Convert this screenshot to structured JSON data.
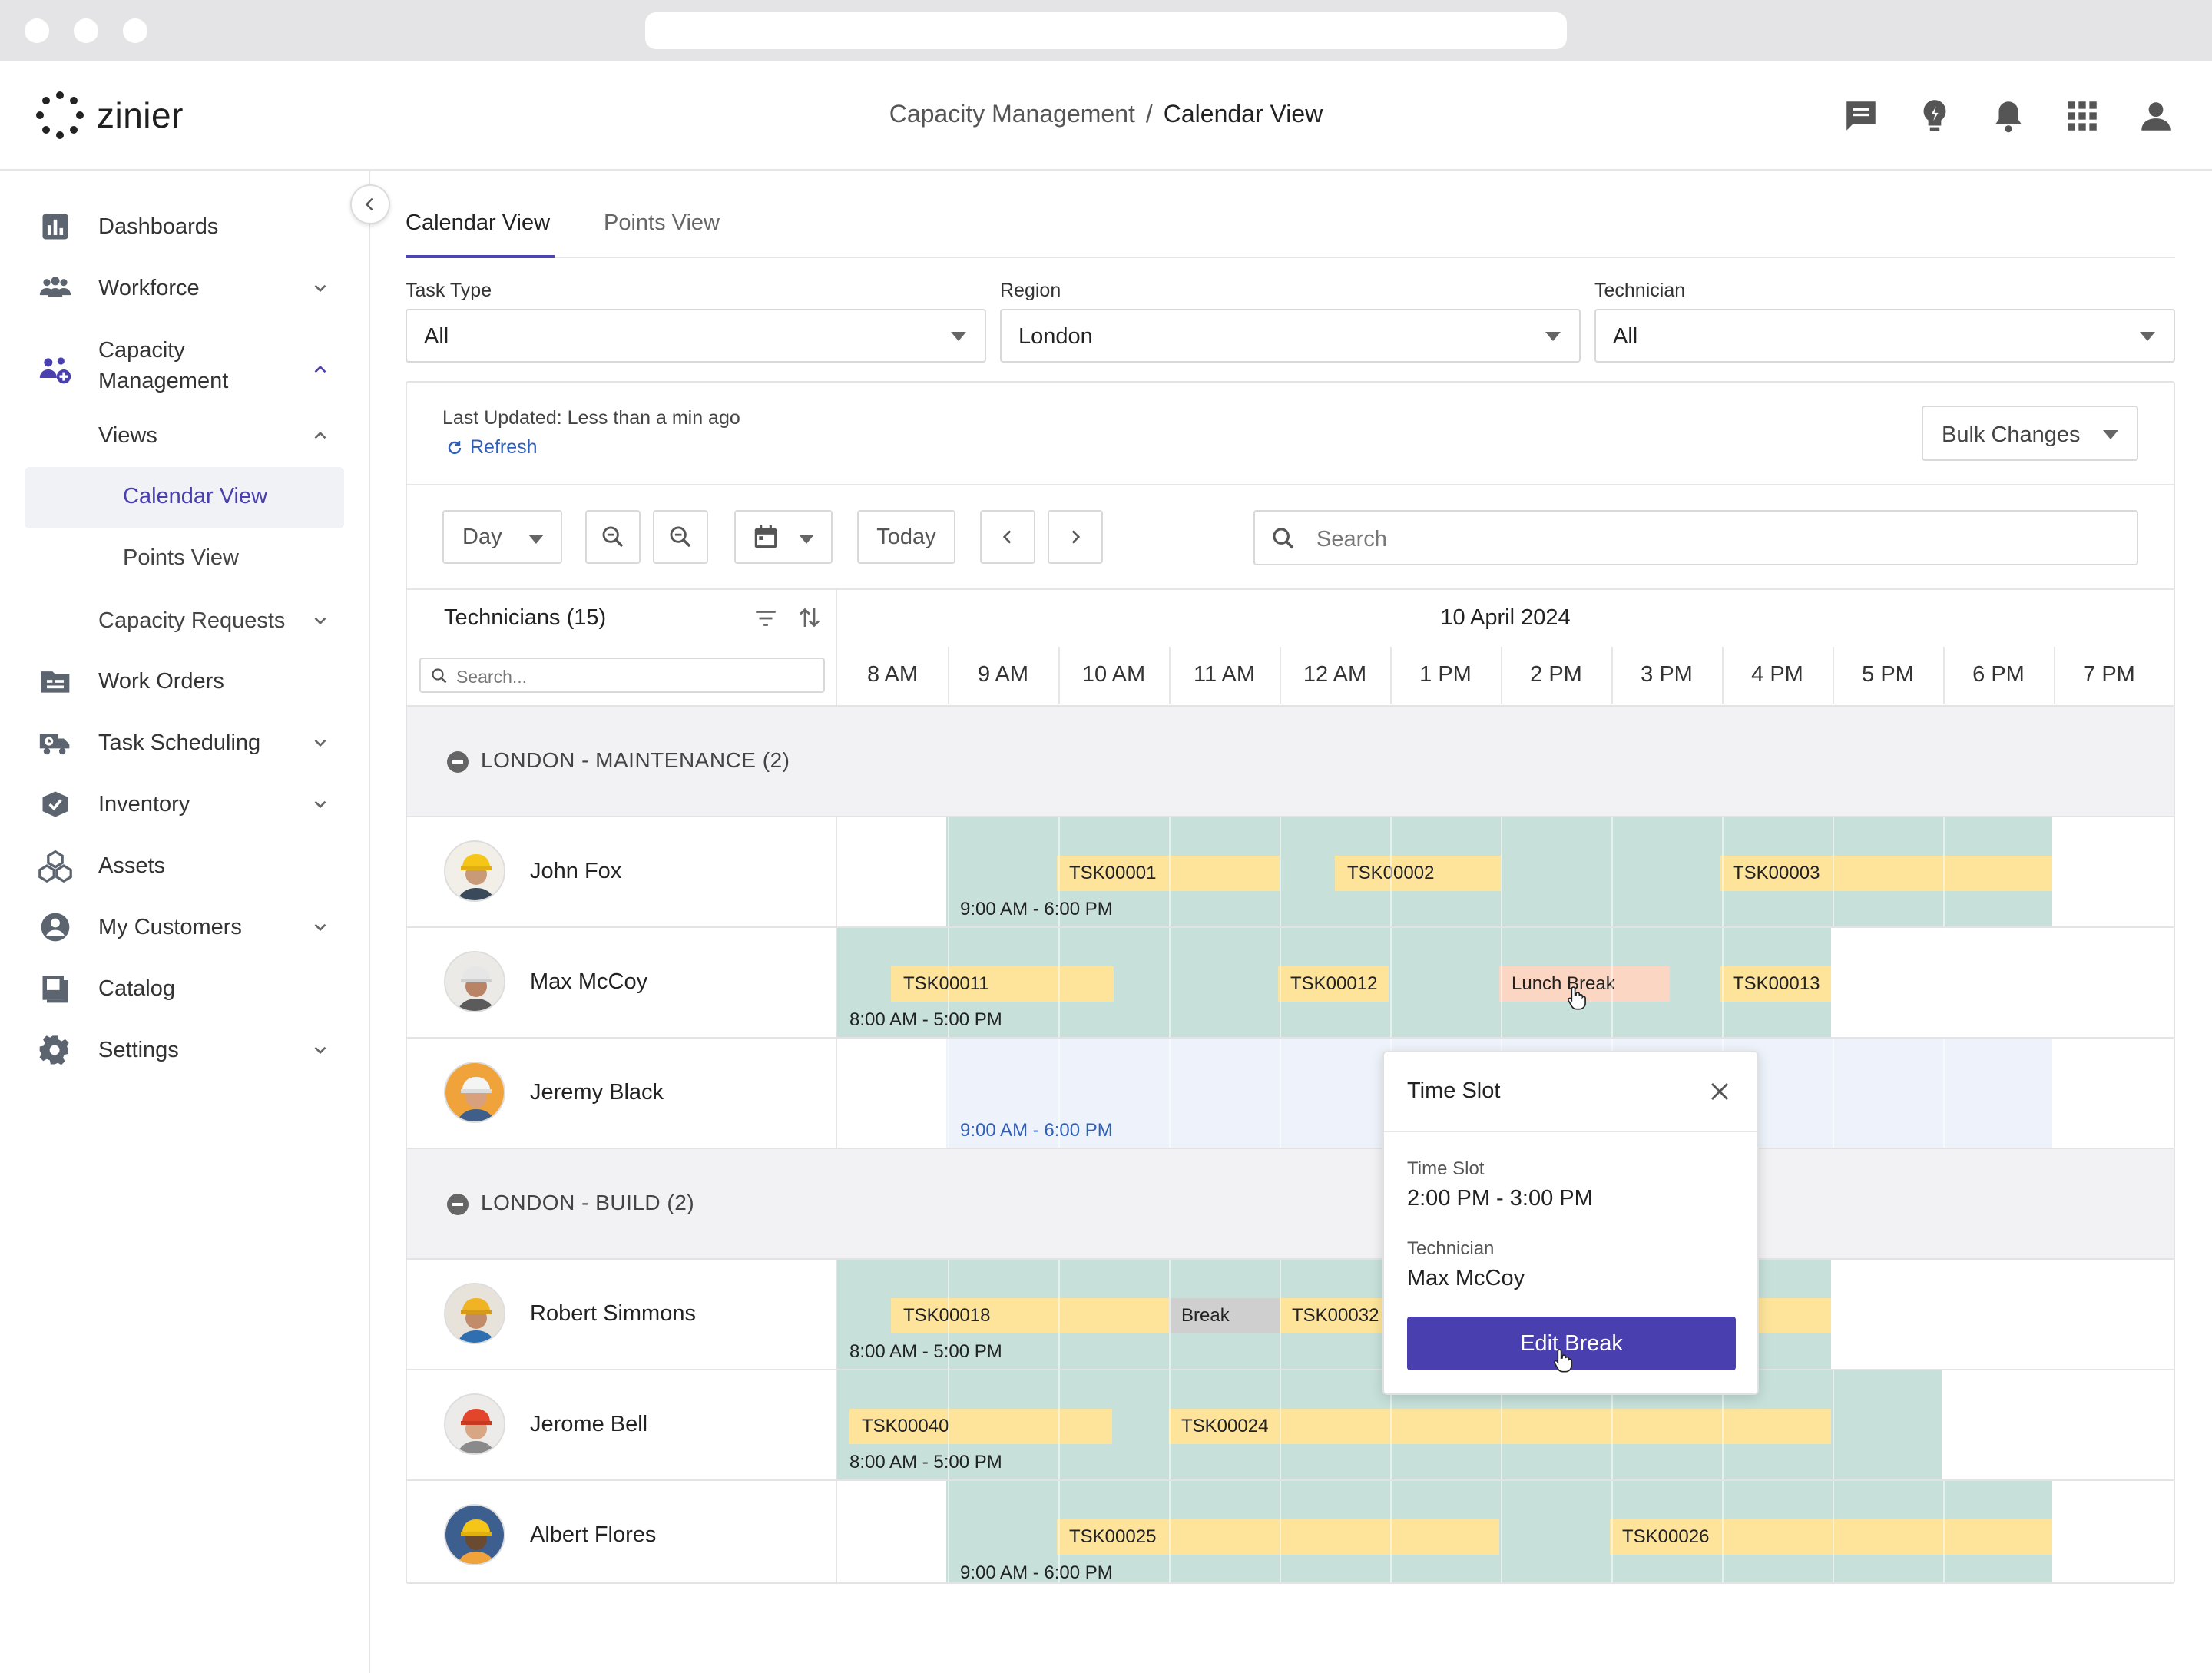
{
  "app": {
    "logo_text": "zinier",
    "breadcrumb": {
      "parent": "Capacity Management",
      "separator": "/",
      "current": "Calendar View"
    }
  },
  "sidebar": {
    "items": [
      {
        "label": "Dashboards",
        "icon": "bar-chart-icon"
      },
      {
        "label": "Workforce",
        "icon": "people-icon"
      },
      {
        "label": "Capacity Management",
        "icon": "capacity-people-icon"
      },
      {
        "label": "Work Orders",
        "icon": "folder-icon"
      },
      {
        "label": "Task Scheduling",
        "icon": "truck-clock-icon"
      },
      {
        "label": "Inventory",
        "icon": "inventory-check-icon"
      },
      {
        "label": "Assets",
        "icon": "boxes-icon"
      },
      {
        "label": "My Customers",
        "icon": "user-circle-icon"
      },
      {
        "label": "Catalog",
        "icon": "catalog-icon"
      },
      {
        "label": "Settings",
        "icon": "gear-icon"
      }
    ],
    "capacity_management_line1": "Capacity",
    "capacity_management_line2": "Management",
    "sub": {
      "views": "Views",
      "calendar_view": "Calendar View",
      "points_view": "Points View",
      "capacity_requests": "Capacity Requests"
    }
  },
  "tabs": [
    "Calendar View",
    "Points View"
  ],
  "filters": {
    "task_type": {
      "label": "Task Type",
      "value": "All"
    },
    "region": {
      "label": "Region",
      "value": "London"
    },
    "technician": {
      "label": "Technician",
      "value": "All"
    }
  },
  "status": {
    "last_updated": "Last Updated: Less than a min ago",
    "refresh": "Refresh"
  },
  "bulk_changes": "Bulk Changes",
  "toolbar": {
    "view_mode": "Day",
    "today": "Today",
    "search_placeholder": "Search"
  },
  "grid": {
    "technicians_header": "Technicians (15)",
    "tech_search_placeholder": "Search...",
    "date": "10 April 2024",
    "hours": [
      "8 AM",
      "9 AM",
      "10 AM",
      "11 AM",
      "12 AM",
      "1 PM",
      "2 PM",
      "3 PM",
      "4 PM",
      "5 PM",
      "6 PM",
      "7 PM"
    ]
  },
  "groups": [
    {
      "label": "LONDON - MAINTENANCE (2)",
      "technicians": [
        {
          "name": "John Fox",
          "shift": "9:00 AM - 6:00 PM",
          "tasks": [
            {
              "label": "TSK00001"
            },
            {
              "label": "TSK00002"
            },
            {
              "label": "TSK00003"
            }
          ]
        },
        {
          "name": "Max McCoy",
          "shift": "8:00 AM - 5:00 PM",
          "tasks": [
            {
              "label": "TSK00011"
            },
            {
              "label": "TSK00012"
            },
            {
              "label": "Lunch Break"
            },
            {
              "label": "TSK00013"
            }
          ]
        },
        {
          "name": "Jeremy Black",
          "shift": "9:00 AM - 6:00 PM",
          "tasks": []
        }
      ]
    },
    {
      "label": "LONDON - BUILD (2)",
      "technicians": [
        {
          "name": "Robert Simmons",
          "shift": "8:00 AM - 5:00 PM",
          "tasks": [
            {
              "label": "TSK00018"
            },
            {
              "label": "Break"
            },
            {
              "label": "TSK00032"
            }
          ]
        },
        {
          "name": "Jerome Bell",
          "shift": "8:00 AM - 5:00 PM",
          "tasks": [
            {
              "label": "TSK00040"
            },
            {
              "label": "TSK00024"
            }
          ]
        },
        {
          "name": "Albert Flores",
          "shift": "9:00 AM - 6:00 PM",
          "tasks": [
            {
              "label": "TSK00025"
            },
            {
              "label": "TSK00026"
            }
          ]
        }
      ]
    }
  ],
  "popup": {
    "title": "Time Slot",
    "time_slot_label": "Time Slot",
    "time_slot_value": "2:00 PM - 3:00 PM",
    "technician_label": "Technician",
    "technician_value": "Max McCoy",
    "button": "Edit Break"
  },
  "colors": {
    "accent": "#4a3fae",
    "shift": "#c7e0da",
    "task": "#fde49a",
    "break": "#cfcfcf",
    "lunch": "#fbd7c3",
    "link": "#2f5fb8"
  }
}
